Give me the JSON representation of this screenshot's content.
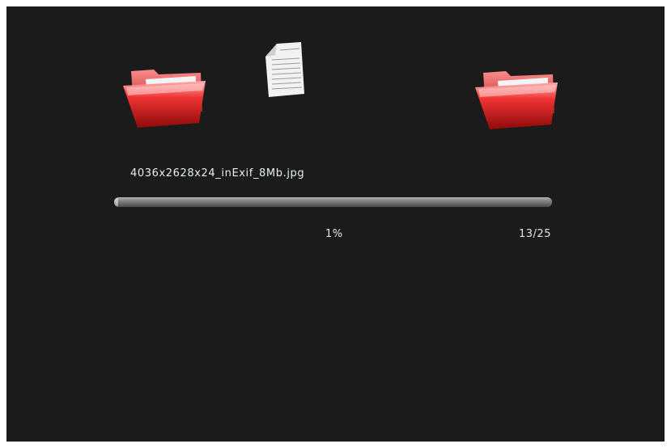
{
  "copy_dialog": {
    "icons": {
      "source": "folder-icon",
      "file": "document-icon",
      "destination": "folder-icon"
    },
    "file_name": "4036x2628x24_inExif_8Mb.jpg",
    "progress_fraction": 0.01,
    "progress_text": "1%",
    "file_counter": "13/25"
  },
  "colors": {
    "background": "#1b1b1b",
    "folder": "#d81f1f",
    "text": "#e6eef0",
    "progress_track": "#7c7c7c"
  }
}
